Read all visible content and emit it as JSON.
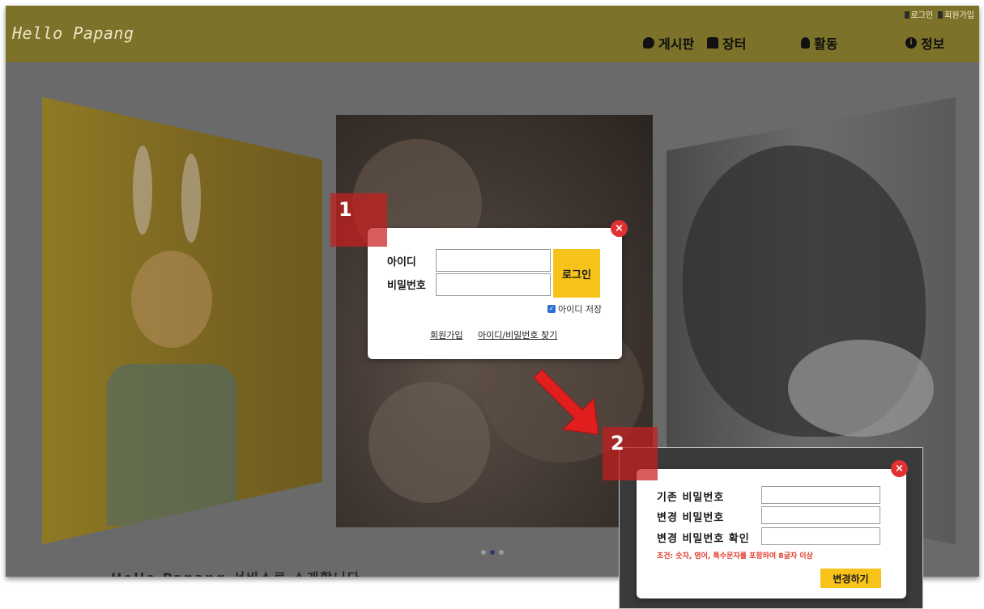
{
  "header": {
    "logo": "Hello Papang",
    "auth": {
      "login": "로그인",
      "signup": "회원가입"
    },
    "nav": [
      {
        "label": "게시판",
        "icon": "speech-bubble-icon"
      },
      {
        "label": "장터",
        "icon": "store-icon"
      },
      {
        "label": "활동",
        "icon": "lightbulb-icon"
      },
      {
        "label": "정보",
        "icon": "info-icon"
      }
    ]
  },
  "carousel": {
    "dots": 3,
    "active_index": 1,
    "caption": "Hello Papang 서비스로 소개합니다"
  },
  "login_modal": {
    "id_label": "아이디",
    "pw_label": "비밀번호",
    "id_value": "",
    "pw_value": "",
    "login_button": "로그인",
    "remember_label": "아이디 저장",
    "remember_checked": true,
    "signup_link": "회원가입",
    "find_link": "아이디/비밀번호 찾기",
    "close_symbol": "×"
  },
  "password_modal": {
    "current_label": "기존 비밀번호",
    "new_label": "변경 비밀번호",
    "confirm_label": "변경 비밀번호 확인",
    "condition": "조건: 숫자, 영어, 특수문자를 포함하여 8글자 이상",
    "submit_button": "변경하기",
    "close_symbol": "×"
  },
  "annotations": {
    "badge_1": "1",
    "badge_2": "2"
  },
  "colors": {
    "header": "#7c7229",
    "accent": "#f7c31a",
    "close": "#e03232",
    "annotation": "#c81e1e"
  }
}
